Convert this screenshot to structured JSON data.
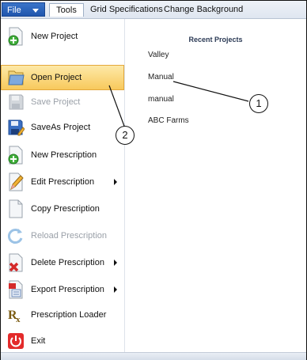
{
  "menubar": {
    "file_label": "File",
    "tabs": [
      {
        "label": "Tools"
      },
      {
        "label": "Grid Specifications"
      },
      {
        "label": "Change Background"
      }
    ]
  },
  "file_menu": {
    "items": [
      {
        "label": "New Project",
        "icon": "new-project-icon",
        "enabled": true,
        "submenu": false
      },
      {
        "label": "Open Project",
        "icon": "open-project-icon",
        "enabled": true,
        "submenu": false,
        "highlighted": true
      },
      {
        "label": "Save Project",
        "icon": "save-project-icon",
        "enabled": false,
        "submenu": false
      },
      {
        "label": "SaveAs Project",
        "icon": "saveas-project-icon",
        "enabled": true,
        "submenu": false
      },
      {
        "label": "New Prescription",
        "icon": "new-prescription-icon",
        "enabled": true,
        "submenu": false
      },
      {
        "label": "Edit Prescription",
        "icon": "edit-prescription-icon",
        "enabled": true,
        "submenu": true
      },
      {
        "label": "Copy Prescription",
        "icon": "copy-prescription-icon",
        "enabled": true,
        "submenu": false
      },
      {
        "label": "Reload Prescription",
        "icon": "reload-prescription-icon",
        "enabled": false,
        "submenu": false
      },
      {
        "label": "Delete Prescription",
        "icon": "delete-prescription-icon",
        "enabled": true,
        "submenu": true
      },
      {
        "label": "Export Prescription",
        "icon": "export-prescription-icon",
        "enabled": true,
        "submenu": true
      },
      {
        "label": "Prescription Loader",
        "icon": "prescription-loader-icon",
        "enabled": true,
        "submenu": false
      },
      {
        "label": "Exit",
        "icon": "exit-icon",
        "enabled": true,
        "submenu": false
      }
    ]
  },
  "recent": {
    "title": "Recent Projects",
    "items": [
      "Valley",
      "Manual",
      "manual",
      "ABC Farms"
    ]
  },
  "callouts": [
    "1",
    "2"
  ],
  "colors": {
    "file_button": "#2a63bd",
    "highlight": "#f8c95c",
    "disabled_text": "#9aa0a8"
  }
}
